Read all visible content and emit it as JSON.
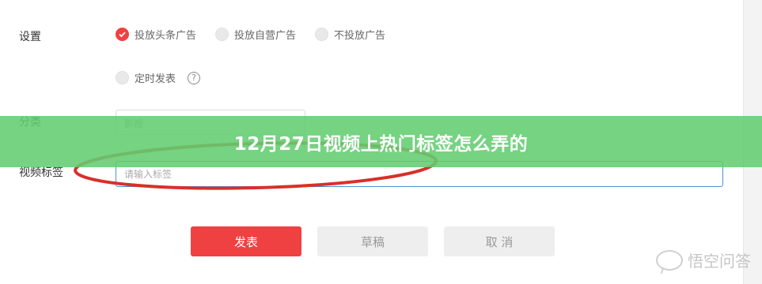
{
  "settings": {
    "label": "设置",
    "options": [
      {
        "label": "投放头条广告",
        "checked": true
      },
      {
        "label": "投放自营广告",
        "checked": false
      },
      {
        "label": "不投放广告",
        "checked": false
      }
    ],
    "schedule_label": "定时发表",
    "help_glyph": "?"
  },
  "category": {
    "label": "分类",
    "value": "影视"
  },
  "tags": {
    "label": "视频标签",
    "placeholder": "请输入标签"
  },
  "banner": {
    "title": "12月27日视频上热门标签怎么弄的",
    "color": "#62cd70"
  },
  "actions": {
    "publish": "发表",
    "draft": "草稿",
    "cancel": "取 消"
  },
  "watermark": {
    "text": "悟空问答"
  },
  "colors": {
    "accent": "#f04142",
    "input_focus": "#4a90e2",
    "annotation": "#d8302a"
  }
}
